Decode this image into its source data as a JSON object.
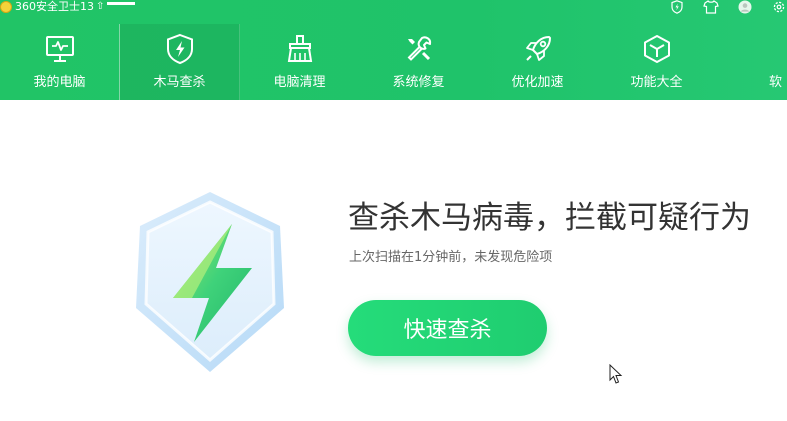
{
  "titlebar": {
    "app_title": "360安全卫士13",
    "icons": [
      "lightning-shield-icon",
      "tshirt-skin-icon",
      "avatar-icon",
      "settings-icon"
    ]
  },
  "nav": {
    "items": [
      {
        "label": "我的电脑",
        "icon": "monitor-icon"
      },
      {
        "label": "木马查杀",
        "icon": "shield-lightning-icon",
        "active": true
      },
      {
        "label": "电脑清理",
        "icon": "broom-icon"
      },
      {
        "label": "系统修复",
        "icon": "wrench-icon"
      },
      {
        "label": "优化加速",
        "icon": "rocket-icon"
      },
      {
        "label": "功能大全",
        "icon": "cube-icon"
      },
      {
        "label": "软"
      }
    ]
  },
  "main": {
    "headline": "查杀木马病毒，拦截可疑行为",
    "subline": "上次扫描在1分钟前，未发现危险项",
    "scan_button": "快速查杀"
  },
  "colors": {
    "header": "#21c466",
    "button": "#22d474",
    "headline": "#333333"
  }
}
